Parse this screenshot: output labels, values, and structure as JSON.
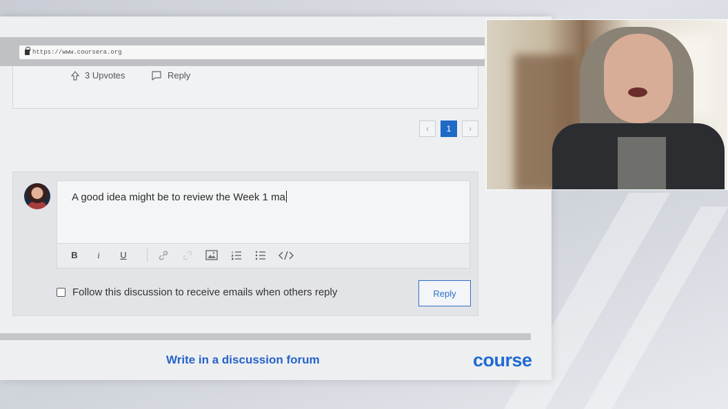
{
  "browser": {
    "url": "https://www.coursera.org"
  },
  "post": {
    "upvotes_label": "3 Upvotes",
    "reply_label": "Reply"
  },
  "pagination": {
    "prev": "‹",
    "current": "1",
    "next": "›"
  },
  "composer": {
    "text": "A good idea might be to review the Week 1 ma",
    "toolbar": {
      "bold": "B",
      "italic": "i",
      "underline": "U"
    },
    "follow_label": "Follow this discussion to receive emails when others reply",
    "follow_checked": false,
    "reply_button": "Reply"
  },
  "caption": "Write in a discussion forum",
  "brand": "course",
  "colors": {
    "accent": "#1f69c7",
    "brand": "#1f6ad3"
  }
}
